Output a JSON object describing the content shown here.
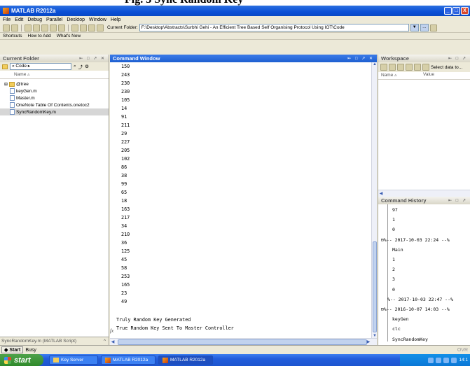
{
  "caption": "Fig. 3 Sync Random Key",
  "window": {
    "title": "MATLAB R2012a",
    "minimize": "_",
    "maximize": "□",
    "close": "X"
  },
  "menu": [
    "File",
    "Edit",
    "Debug",
    "Parallel",
    "Desktop",
    "Window",
    "Help"
  ],
  "toolbar": {
    "current_folder_label": "Current Folder:",
    "current_folder_value": "F:\\Desktop\\Abstracts\\Surbhi Gehi - An Efficient Tree Based Self Organising Protocol Using IOT\\Code",
    "browse": "..."
  },
  "shortcuts": [
    "Shortcuts",
    "How to Add",
    "What's New"
  ],
  "current_folder": {
    "title": "Current Folder",
    "path": "« Code ▸",
    "column_name": "Name ▵",
    "items": [
      {
        "name": "@tree",
        "type": "folder"
      },
      {
        "name": "keyGen.m",
        "type": "file"
      },
      {
        "name": "Master.m",
        "type": "file"
      },
      {
        "name": "OneNote Table Of Contents.onetoc2",
        "type": "file"
      },
      {
        "name": "SyncRandomKey.m",
        "type": "file"
      }
    ],
    "details": "SyncRandomKey.m (MATLAB Script)"
  },
  "command_window": {
    "title": "Command Window",
    "numbers": [
      "150",
      "243",
      "230",
      "230",
      "105",
      "14",
      "91",
      "211",
      "29",
      "227",
      "205",
      "102",
      "86",
      "38",
      "99",
      "65",
      "18",
      "163",
      "217",
      "34",
      "210",
      "36",
      "125",
      "45",
      "58",
      "253",
      "165",
      "23",
      "49"
    ],
    "message_1": "Truly Random Key Generated",
    "message_2": "True Random Key Sent To Master Controller",
    "prompt": "fx"
  },
  "workspace": {
    "title": "Workspace",
    "select_data": "Select data to...",
    "col_name": "Name ▵",
    "col_value": "Value"
  },
  "command_history": {
    "title": "Command History",
    "entries": [
      "97",
      "1",
      "0",
      "%-- 2017-10-03 22:24 --%",
      "Main",
      "1",
      "2",
      "3",
      "0",
      "%-- 2017-10-03 22:47 --%",
      "%-- 2016-10-07 14:03 --%",
      "keyGen",
      "clc",
      "SyncRandomKey"
    ]
  },
  "status": {
    "start": "Start",
    "busy": "Busy",
    "ovr": "OVR"
  },
  "taskbar": {
    "start": "start",
    "tasks": [
      "Key Server",
      "MATLAB R2012a",
      "MATLAB R2012a"
    ],
    "clock": "14:1"
  }
}
